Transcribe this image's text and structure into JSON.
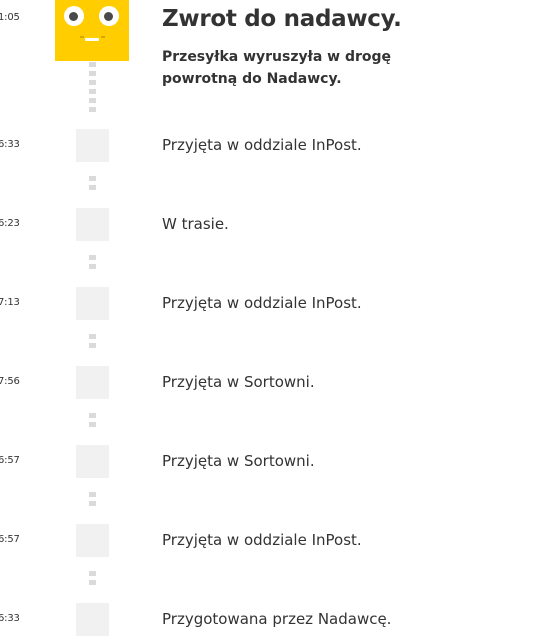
{
  "header": {
    "time": "1:05",
    "title": "Zwrot do nadawcy.",
    "subtitle": "Przesyłka wyruszyła w drogę powrotną do Nadawcy.",
    "mascot_icon": "inpost-yellow-face-icon",
    "accent_color": "#ffcd00"
  },
  "events": [
    {
      "time": "6:33",
      "label": "Przyjęta w oddziale InPost."
    },
    {
      "time": "6:23",
      "label": "W trasie."
    },
    {
      "time": "7:13",
      "label": "Przyjęta w oddziale InPost."
    },
    {
      "time": "7:56",
      "label": "Przyjęta w Sortowni."
    },
    {
      "time": "6:57",
      "label": "Przyjęta w Sortowni."
    },
    {
      "time": "6:57",
      "label": "Przyjęta w oddziale InPost."
    },
    {
      "time": "6:33",
      "label": "Przygotowana przez Nadawcę."
    }
  ]
}
